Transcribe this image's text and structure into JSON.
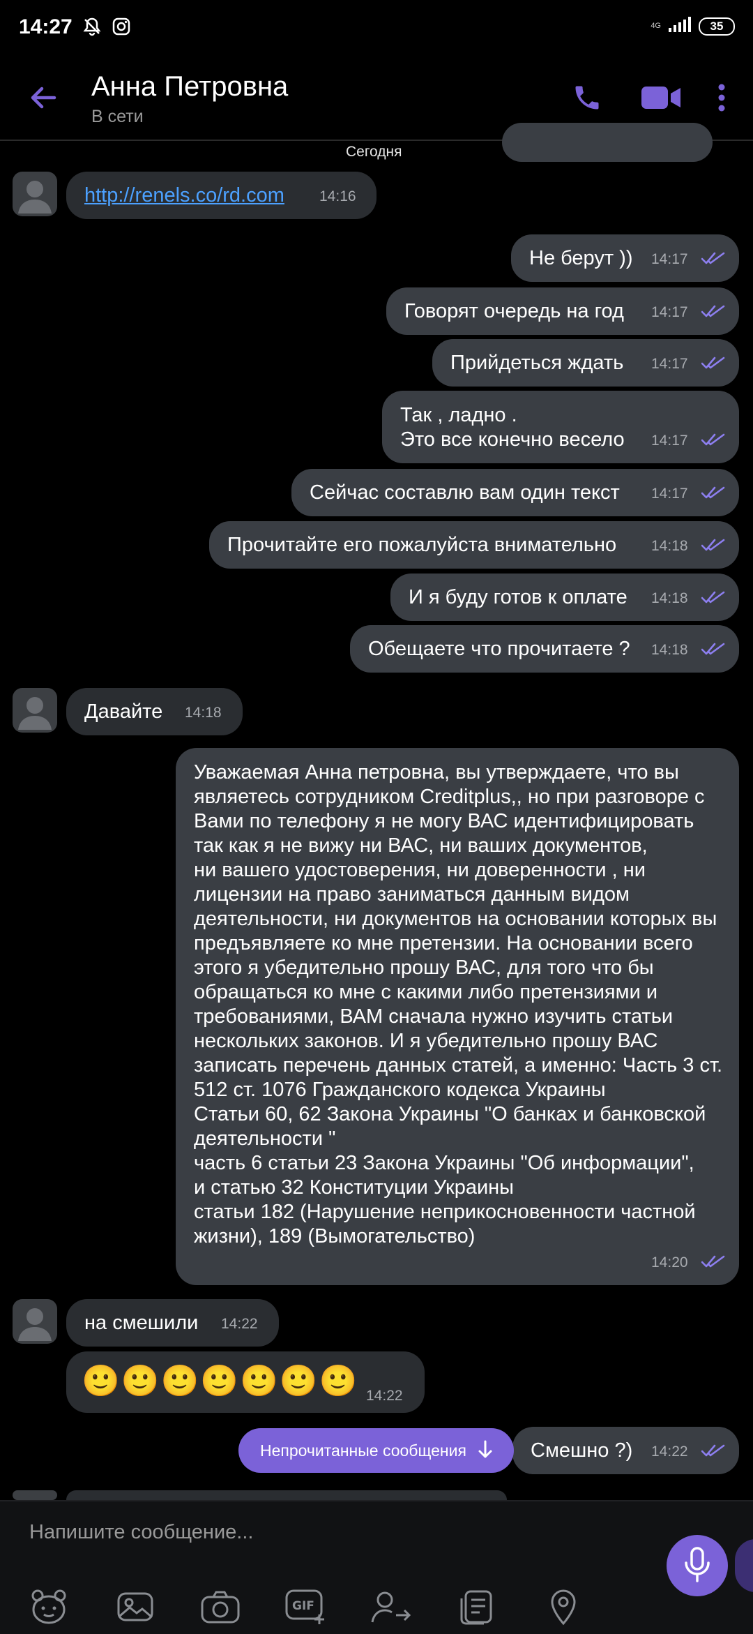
{
  "status_bar": {
    "time": "14:27",
    "network": "4G",
    "battery": "35"
  },
  "header": {
    "name": "Анна Петровна",
    "status": "В сети"
  },
  "chat": {
    "date_separator": "Сегодня",
    "msg_link": {
      "text": "http://renels.co/rd.com",
      "time": "14:16"
    },
    "out": [
      {
        "text": "Не берут ))",
        "time": "14:17"
      },
      {
        "text": "Говорят очередь на год",
        "time": "14:17"
      },
      {
        "text": "Прийдеться ждать",
        "time": "14:17"
      },
      {
        "text": "Так , ладно .\nЭто все конечно весело",
        "time": "14:17"
      },
      {
        "text": "Сейчас составлю вам один текст",
        "time": "14:17"
      },
      {
        "text": "Прочитайте его пожалуйста внимательно",
        "time": "14:18"
      },
      {
        "text": "И я буду готов к оплате",
        "time": "14:18"
      },
      {
        "text": "Обещаете что прочитаете ?",
        "time": "14:18"
      }
    ],
    "in_davayte": {
      "text": "Давайте",
      "time": "14:18"
    },
    "long_msg": {
      "text": "Уважаемая Анна петровна, вы утверждаете, что вы являетесь сотрудником Creditplus,, но при разговоре с Вами по телефону я не могу ВАС идентифицировать так как я не вижу ни ВАС, ни ваших документов,\nни вашего удостоверения, ни доверенности , ни лицензии на право заниматься данным видом деятельности, ни документов на основании которых вы предъявляете ко мне претензии. На основании всего этого я убедительно прошу ВАС, для того что бы обращаться ко мне с какими либо претензиями и требованиями, ВАМ сначала нужно изучить статьи нескольких законов. И я убедительно прошу ВАС записать перечень данных статей, а именно: Часть 3 ст. 512 ст. 1076 Гражданского кодекса Украины\nСтатьи 60, 62 Закона Украины \"О банках и банковской деятельности \"\nчасть 6 статьи 23 Закона Украины \"Об информации\",\nи статью 32 Конституции Украины\nстатьи 182 (Нарушение неприкосновенности частной жизни), 189 (Вымогательство)",
      "time": "14:20"
    },
    "in_smeshili": {
      "text": "на смешили",
      "time": "14:22"
    },
    "in_emoji": {
      "text": "🙂🙂🙂🙂🙂🙂🙂",
      "time": "14:22"
    },
    "out_smeshno": {
      "text": "Смешно ?)",
      "time": "14:22"
    },
    "unread_pill": "Непрочитанные сообщения"
  },
  "composer": {
    "placeholder": "Напишите сообщение..."
  },
  "colors": {
    "accent": "#7b62d8",
    "outgoing_bubble": "#3a3e44",
    "incoming_bubble": "#2a2d31",
    "link": "#4ca1ff"
  }
}
